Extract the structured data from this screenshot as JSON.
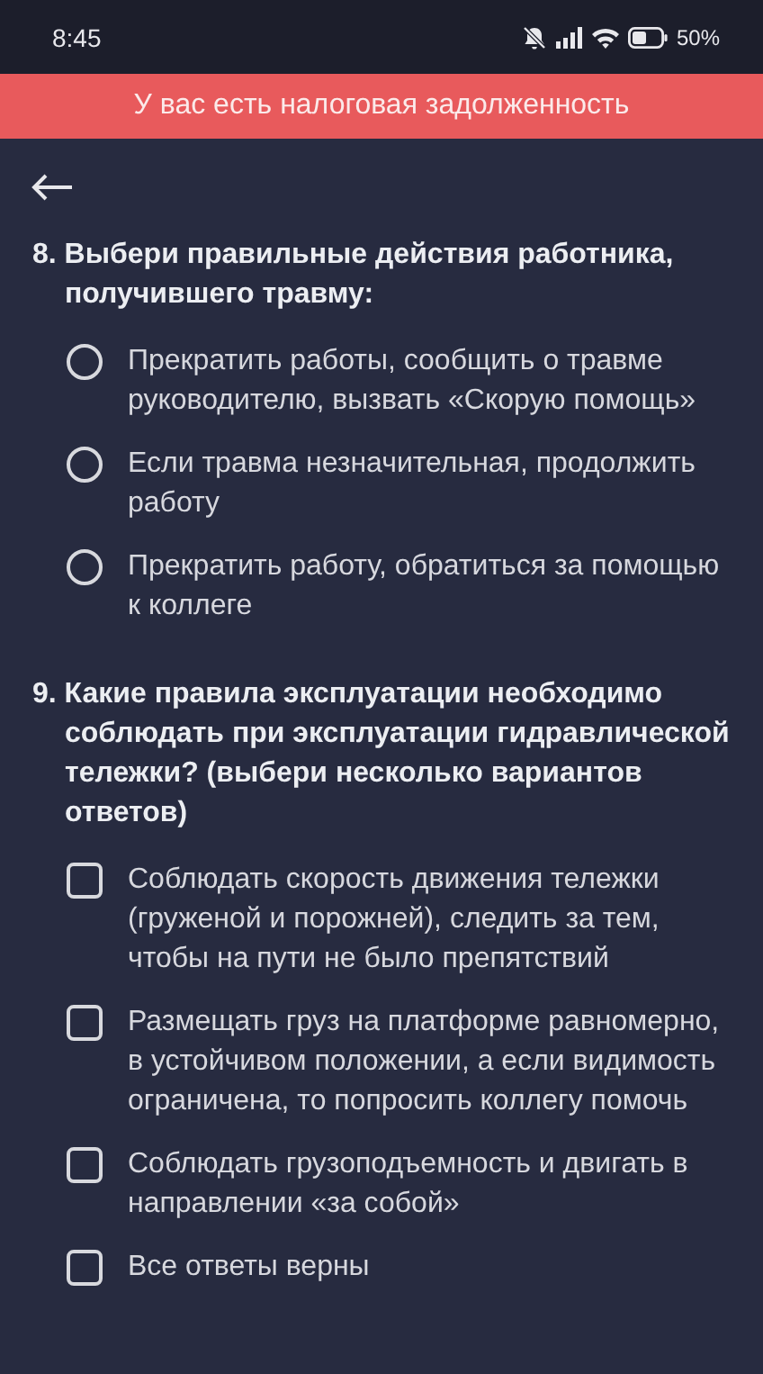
{
  "status_bar": {
    "time": "8:45",
    "battery": "50%"
  },
  "banner": {
    "text": "У вас есть налоговая задолженность"
  },
  "questions": [
    {
      "text": "8. Выбери правильные действия работника, получившего травму:",
      "kind": "radio",
      "options": [
        {
          "text": "Прекратить работы, сообщить о травме руководителю, вызвать «Скорую помощь»",
          "selected": false
        },
        {
          "text": "Если травма незначительная, продолжить работу",
          "selected": false
        },
        {
          "text": "Прекратить работу, обратиться за помощью к коллеге",
          "selected": false
        }
      ]
    },
    {
      "text": "9. Какие правила эксплуатации необходимо соблюдать при эксплуатации гидравлической тележки? (выбери несколько вариантов ответов)",
      "kind": "checkbox",
      "options": [
        {
          "text": "Соблюдать скорость движения тележки (груженой и порожней), следить за тем, чтобы на пути не было препятствий",
          "checked": false
        },
        {
          "text": "Размещать груз на платформе равномерно, в устойчивом положении, а если видимость ограничена, то попросить коллегу помочь",
          "checked": false
        },
        {
          "text": "Соблюдать грузоподъемность и двигать в направлении «за собой»",
          "checked": false
        },
        {
          "text": "Все ответы верны",
          "checked": false
        }
      ]
    }
  ]
}
